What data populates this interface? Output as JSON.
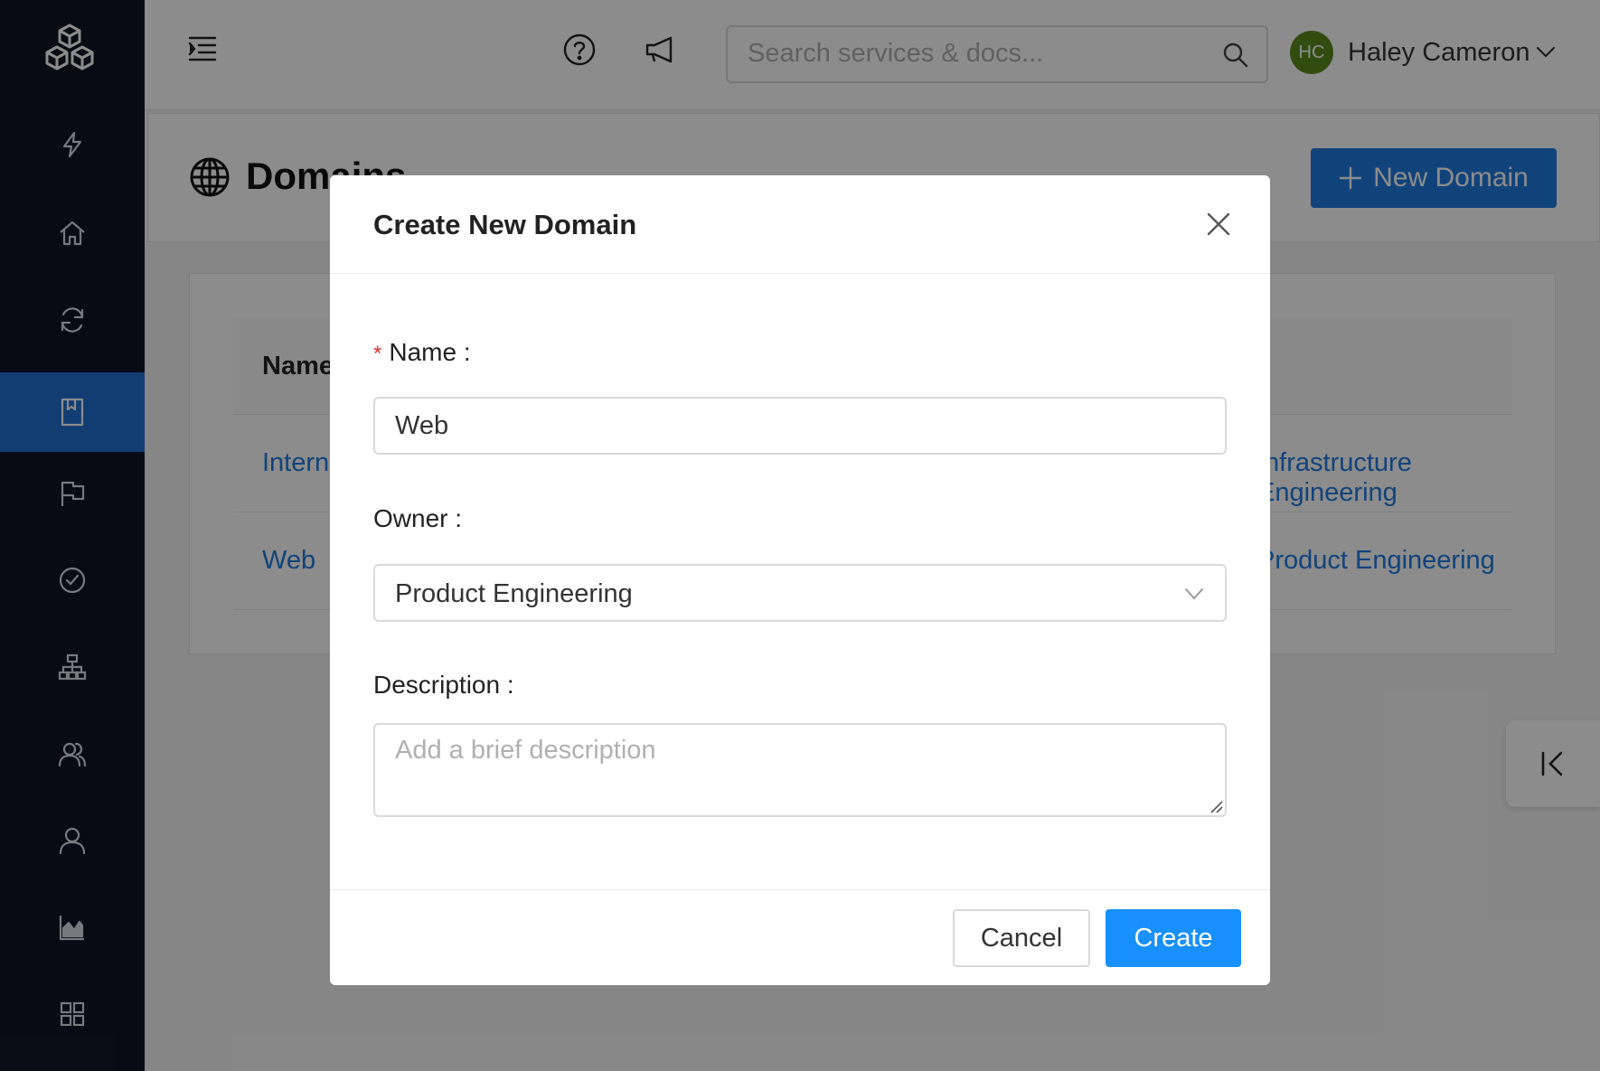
{
  "sidebar": {
    "logo_icon": "cubes-logo-icon",
    "items": [
      {
        "icon": "lightning-icon",
        "active": false
      },
      {
        "icon": "home-icon",
        "active": false
      },
      {
        "icon": "refresh-icon",
        "active": false
      },
      {
        "icon": "bookmark-icon",
        "active": true
      },
      {
        "icon": "flag-icon",
        "active": false
      },
      {
        "icon": "check-circle-icon",
        "active": false
      },
      {
        "icon": "hierarchy-icon",
        "active": false
      },
      {
        "icon": "team-icon",
        "active": false
      },
      {
        "icon": "user-icon",
        "active": false
      },
      {
        "icon": "area-chart-icon",
        "active": false
      },
      {
        "icon": "grid-icon",
        "active": false
      }
    ],
    "active_color": "#1f6fd1",
    "bg_color": "#0c1526"
  },
  "topbar": {
    "search_placeholder": "Search services & docs...",
    "user": {
      "initials": "HC",
      "name": "Haley Cameron",
      "avatar_color": "#5b8a1e"
    }
  },
  "page": {
    "title": "Domains",
    "new_button_label": "New Domain"
  },
  "table": {
    "header_name": "Name",
    "rows": [
      {
        "name": "Internal",
        "owner": "Infrastructure Engineering"
      },
      {
        "name": "Web",
        "owner": "Product Engineering"
      }
    ]
  },
  "modal": {
    "title": "Create New Domain",
    "name_label": "Name",
    "name_value": "Web",
    "owner_label": "Owner",
    "owner_value": "Product Engineering",
    "description_label": "Description",
    "description_placeholder": "Add a brief description",
    "cancel_label": "Cancel",
    "create_label": "Create",
    "primary_color": "#1890ff"
  }
}
